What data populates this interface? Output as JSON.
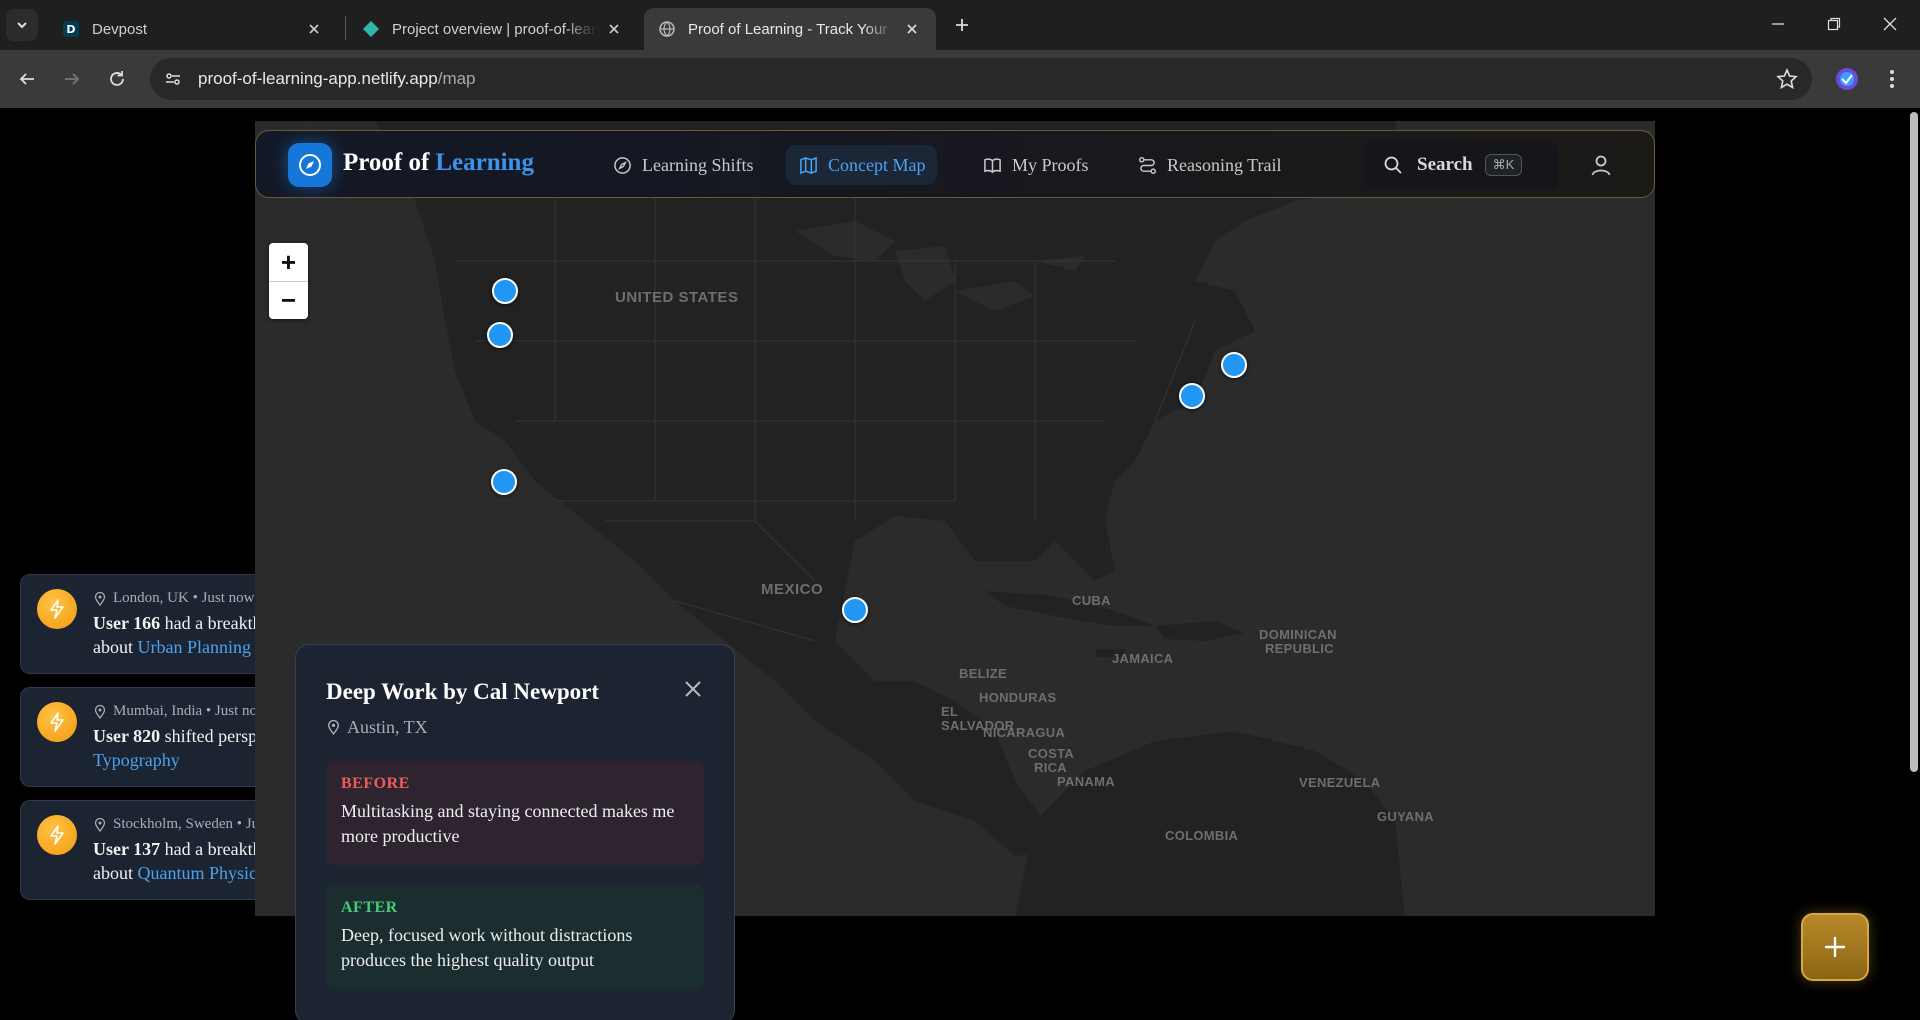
{
  "browser": {
    "tabs": [
      {
        "title": "Devpost",
        "favicon": "devpost-icon",
        "active": false
      },
      {
        "title": "Project overview | proof-of-learning",
        "favicon": "netlify-icon",
        "active": false
      },
      {
        "title": "Proof of Learning - Track Your Learning",
        "favicon": "globe-icon",
        "active": true
      }
    ],
    "url_host": "proof-of-learning-app.netlify.app",
    "url_path": "/map"
  },
  "header": {
    "brand_main": "Proof of",
    "brand_accent": "Learning",
    "nav": [
      {
        "label": "Learning Shifts",
        "icon": "compass-icon",
        "active": false
      },
      {
        "label": "Concept Map",
        "icon": "map-icon",
        "active": true
      },
      {
        "label": "My Proofs",
        "icon": "book-icon",
        "active": false
      },
      {
        "label": "Reasoning Trail",
        "icon": "route-icon",
        "active": false
      }
    ],
    "search_label": "Search",
    "search_shortcut": "⌘K"
  },
  "map": {
    "zoom_in": "+",
    "zoom_out": "−",
    "labels": {
      "united_states": "UNITED STATES",
      "mexico": "MEXICO",
      "cuba": "CUBA",
      "jamaica": "JAMAICA",
      "dominican_republic_1": "DOMINICAN",
      "dominican_republic_2": "REPUBLIC",
      "belize": "BELIZE",
      "honduras": "HONDURAS",
      "el_salvador_1": "EL",
      "el_salvador_2": "SALVADOR",
      "nicaragua": "NICARAGUA",
      "costa_rica_1": "COSTA",
      "costa_rica_2": "RICA",
      "panama": "PANAMA",
      "venezuela": "VENEZUELA",
      "guyana": "GUYANA",
      "colombia": "COLOMBIA"
    }
  },
  "feed": [
    {
      "location": "London, UK • Just now",
      "user": "User 166",
      "line1_rest": " had a breakthrough",
      "line2_prefix": "about ",
      "topic": "Urban Planning"
    },
    {
      "location": "Mumbai, India • Just now",
      "user": "User 820",
      "line1_rest": " shifted perspective on",
      "line2_prefix": "",
      "topic": "Typography"
    },
    {
      "location": "Stockholm, Sweden • Just now",
      "user": "User 137",
      "line1_rest": " had a breakthrough",
      "line2_prefix": "about ",
      "topic": "Quantum Physics"
    }
  ],
  "popup": {
    "title": "Deep Work by Cal Newport",
    "location": "Austin, TX",
    "before_label": "BEFORE",
    "before_text": "Multitasking and staying connected makes me more productive",
    "after_label": "AFTER",
    "after_text": "Deep, focused work without distractions produces the highest quality output"
  },
  "colors": {
    "accent_blue": "#3d93ea",
    "pin_blue": "#2196f3",
    "before_red": "#ef5a5a",
    "after_green": "#3fcf76",
    "fab_gold": "#b8892a"
  }
}
